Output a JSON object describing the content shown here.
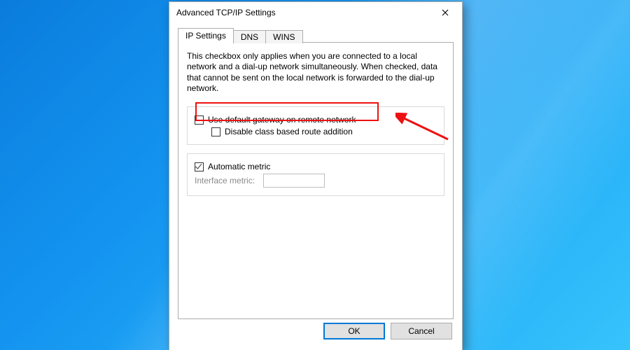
{
  "window": {
    "title": "Advanced TCP/IP Settings"
  },
  "tabs": {
    "ip": "IP Settings",
    "dns": "DNS",
    "wins": "WINS"
  },
  "body": {
    "description": "This checkbox only applies when you are connected to a local network and a dial-up network simultaneously.  When checked, data that cannot be sent on the local network is forwarded to the dial-up network.",
    "use_default_gateway_label": "Use default gateway on remote network",
    "use_default_gateway_checked": false,
    "disable_class_route_label": "Disable class based route addition",
    "disable_class_route_checked": false,
    "automatic_metric_label": "Automatic metric",
    "automatic_metric_checked": true,
    "interface_metric_label": "Interface metric:"
  },
  "buttons": {
    "ok": "OK",
    "cancel": "Cancel"
  }
}
